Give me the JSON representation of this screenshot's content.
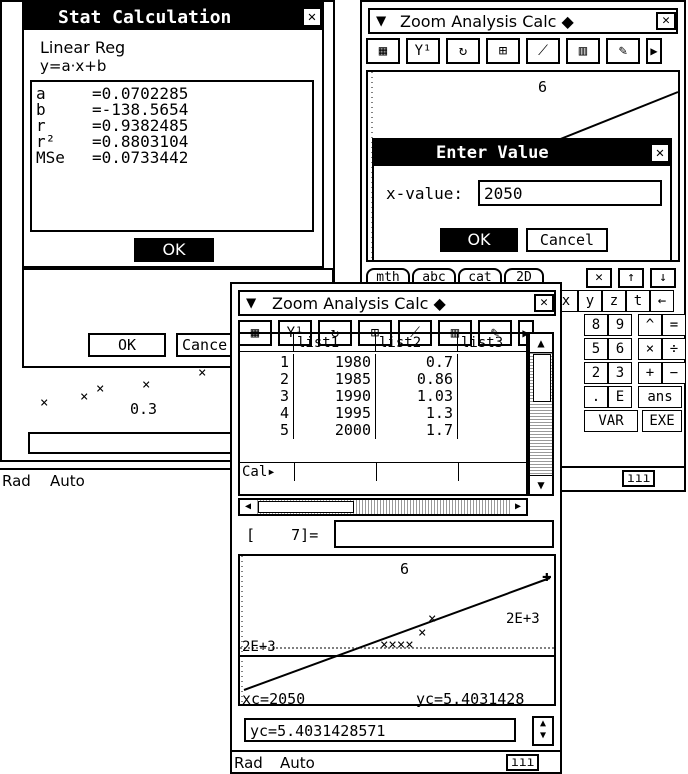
{
  "stat": {
    "title": "Stat Calculation",
    "close": "✕",
    "lines": [
      "Linear Reg",
      "y=a·x+b"
    ],
    "results": [
      {
        "name": "a",
        "value": "=0.0702285"
      },
      {
        "name": "b",
        "value": "=-138.5654"
      },
      {
        "name": "r",
        "value": "=0.9382485"
      },
      {
        "name": "r²",
        "value": "=0.8803104"
      },
      {
        "name": "MSe",
        "value": "=0.0733442"
      }
    ],
    "ok": "OK",
    "behind_ok": "OK",
    "behind_cancel": "Cance",
    "graph_label": "0.3",
    "status": [
      "Rad",
      "Auto"
    ]
  },
  "enter": {
    "menu_title": "Zoom Analysis Calc ◆",
    "close": "✕",
    "graph_label": "6",
    "dialog_title": "Enter Value",
    "field_label": "x-value:",
    "field_value": "2050",
    "ok": "OK",
    "cancel": "Cancel",
    "kbd_tabs": [
      "mth",
      "abc",
      "cat",
      "2D"
    ],
    "keys": [
      "x",
      "y",
      "z",
      "t",
      "←",
      "8",
      "9",
      "^",
      "=",
      "5",
      "6",
      "×",
      "÷",
      "2",
      "3",
      "+",
      "−",
      ".",
      "E",
      "ans",
      "VAR",
      "EXE"
    ]
  },
  "main": {
    "menu_title": "Zoom Analysis Calc ◆",
    "close": "✕",
    "columns": [
      "",
      "list1",
      "list2",
      "list3"
    ],
    "rows": [
      {
        "n": "1",
        "l1": "1980",
        "l2": "0.7"
      },
      {
        "n": "2",
        "l1": "1985",
        "l2": "0.86"
      },
      {
        "n": "3",
        "l1": "1990",
        "l2": "1.03"
      },
      {
        "n": "4",
        "l1": "1995",
        "l2": "1.3"
      },
      {
        "n": "5",
        "l1": "2000",
        "l2": "1.7"
      }
    ],
    "cal_label": "Cal▸",
    "cell_ref": "[    7]=",
    "graph_top": "6",
    "graph_right": "2E+3",
    "graph_left": "2E+3",
    "xc": "xc=2050",
    "yc": "yc=5.4031428",
    "entry": "yc=5.4031428571",
    "status": [
      "Rad",
      "Auto"
    ]
  }
}
